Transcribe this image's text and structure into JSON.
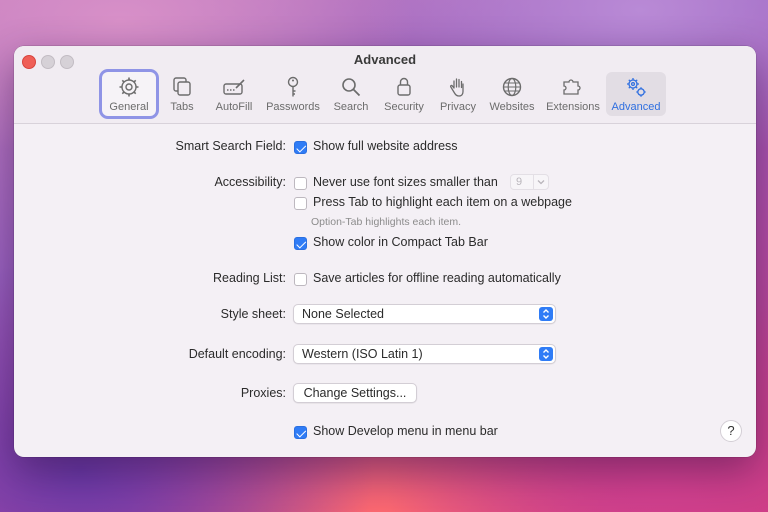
{
  "window": {
    "title": "Advanced"
  },
  "tabs": [
    {
      "label": "General",
      "icon": "gear-icon"
    },
    {
      "label": "Tabs",
      "icon": "tabs-icon"
    },
    {
      "label": "AutoFill",
      "icon": "autofill-pencil-icon"
    },
    {
      "label": "Passwords",
      "icon": "key-icon"
    },
    {
      "label": "Search",
      "icon": "magnifier-icon"
    },
    {
      "label": "Security",
      "icon": "lock-icon"
    },
    {
      "label": "Privacy",
      "icon": "hand-icon"
    },
    {
      "label": "Websites",
      "icon": "globe-icon"
    },
    {
      "label": "Extensions",
      "icon": "puzzle-icon"
    },
    {
      "label": "Advanced",
      "icon": "gears-icon"
    }
  ],
  "selected_tab": "Advanced",
  "accent_color": "#2f7cf6",
  "settings": {
    "smart_search": {
      "label": "Smart Search Field:",
      "show_full_address": {
        "label": "Show full website address",
        "checked": true
      }
    },
    "accessibility": {
      "label": "Accessibility:",
      "min_font": {
        "label": "Never use font sizes smaller than",
        "checked": false,
        "value": "9"
      },
      "press_tab": {
        "label": "Press Tab to highlight each item on a webpage",
        "checked": false
      },
      "hint": "Option-Tab highlights each item.",
      "compact_color": {
        "label": "Show color in Compact Tab Bar",
        "checked": true
      }
    },
    "reading_list": {
      "label": "Reading List:",
      "save_offline": {
        "label": "Save articles for offline reading automatically",
        "checked": false
      }
    },
    "style_sheet": {
      "label": "Style sheet:",
      "value": "None Selected"
    },
    "default_encoding": {
      "label": "Default encoding:",
      "value": "Western (ISO Latin 1)"
    },
    "proxies": {
      "label": "Proxies:",
      "button": "Change Settings..."
    },
    "develop_menu": {
      "label": "Show Develop menu in menu bar",
      "checked": true
    }
  },
  "help": {
    "label": "?"
  }
}
